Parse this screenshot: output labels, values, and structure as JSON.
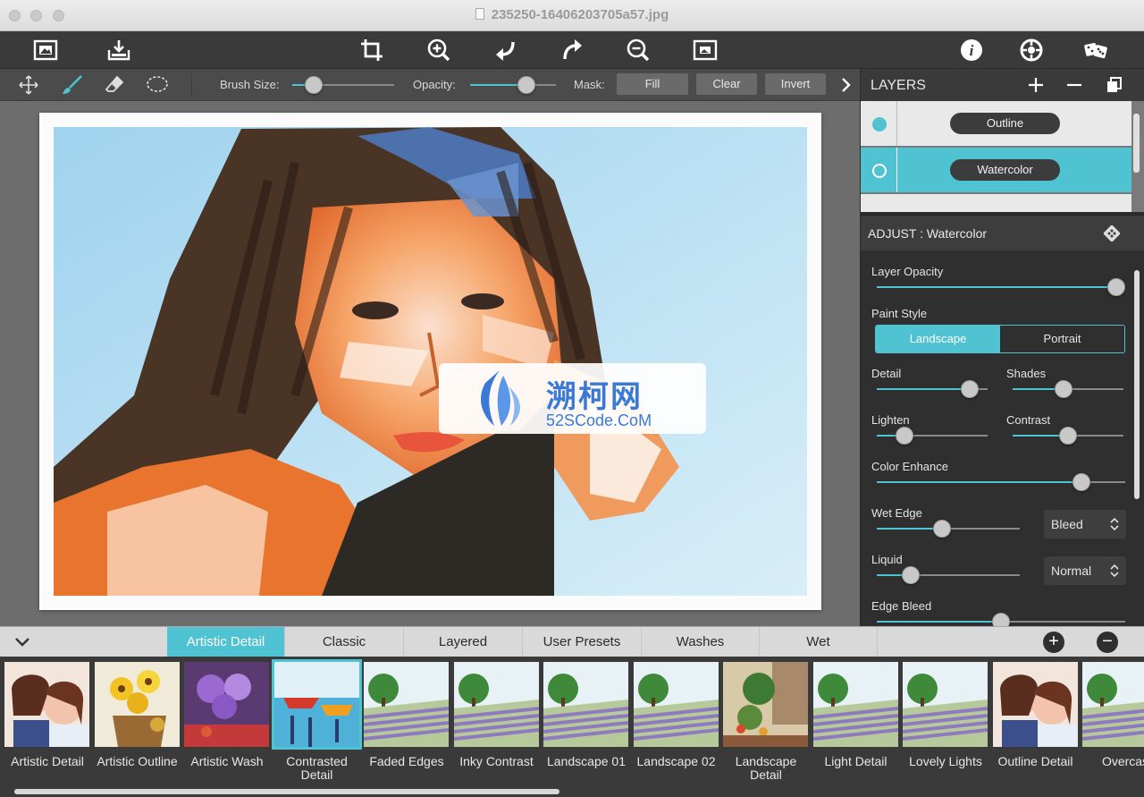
{
  "window": {
    "title": "235250-16406203705a57.jpg"
  },
  "toolbar": {
    "left_icons": [
      "open-image-icon",
      "save-icon"
    ],
    "center_icons": [
      "crop-icon",
      "zoom-in-icon",
      "undo-icon",
      "redo-icon",
      "zoom-out-icon",
      "fit-image-icon"
    ],
    "right_icons": [
      "info-icon",
      "settings-icon",
      "randomize-icon"
    ]
  },
  "brushbar": {
    "brush_size_label": "Brush Size:",
    "brush_size": 0.15,
    "opacity_label": "Opacity:",
    "opacity": 0.7,
    "mask_label": "Mask:",
    "fill_label": "Fill",
    "clear_label": "Clear",
    "invert_label": "Invert"
  },
  "layers": {
    "title": "LAYERS",
    "items": [
      {
        "label": "Outline",
        "selected": false
      },
      {
        "label": "Watercolor",
        "selected": true
      }
    ]
  },
  "adjust": {
    "title": "ADJUST : Watercolor",
    "layer_opacity_label": "Layer Opacity",
    "layer_opacity": 1.0,
    "paint_style_label": "Paint Style",
    "paint_style_options": [
      "Landscape",
      "Portrait"
    ],
    "paint_style_selected": "Landscape",
    "detail_label": "Detail",
    "detail": 0.9,
    "shades_label": "Shades",
    "shades": 0.45,
    "lighten_label": "Lighten",
    "lighten": 0.2,
    "contrast_label": "Contrast",
    "contrast": 0.5,
    "color_enhance_label": "Color Enhance",
    "color_enhance": 0.85,
    "wet_edge_label": "Wet Edge",
    "wet_edge": 0.45,
    "wet_edge_mode": "Bleed",
    "liquid_label": "Liquid",
    "liquid": 0.2,
    "liquid_mode": "Normal",
    "edge_bleed_label": "Edge Bleed",
    "edge_bleed": 0.5
  },
  "watermark": {
    "title": "溯柯网",
    "subtitle": "52SCode.CoM"
  },
  "presets": {
    "tabs": [
      "Artistic Detail",
      "Classic",
      "Layered",
      "User Presets",
      "Washes",
      "Wet"
    ],
    "active_tab": "Artistic Detail",
    "items": [
      {
        "label": "Artistic Detail",
        "theme": "portrait"
      },
      {
        "label": "Artistic Outline",
        "theme": "flowers-yellow"
      },
      {
        "label": "Artistic Wash",
        "theme": "flowers-purple"
      },
      {
        "label": "Contrasted Detail",
        "theme": "boats"
      },
      {
        "label": "Faded Edges",
        "theme": "landscape"
      },
      {
        "label": "Inky Contrast",
        "theme": "landscape"
      },
      {
        "label": "Landscape 01",
        "theme": "landscape"
      },
      {
        "label": "Landscape 02",
        "theme": "landscape"
      },
      {
        "label": "Landscape Detail",
        "theme": "garden"
      },
      {
        "label": "Light Detail",
        "theme": "landscape"
      },
      {
        "label": "Lovely Lights",
        "theme": "landscape"
      },
      {
        "label": "Outline Detail",
        "theme": "portrait"
      },
      {
        "label": "Overcas",
        "theme": "landscape"
      }
    ]
  },
  "colors": {
    "accent": "#4fc3d1",
    "panel": "#2f2f2f",
    "toolbar": "#3a3a3a"
  }
}
